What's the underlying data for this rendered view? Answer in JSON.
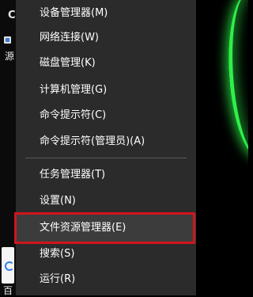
{
  "desktop": {
    "label_top": "C",
    "label_mid": "源",
    "label_bottom": "百"
  },
  "menu": {
    "items": [
      {
        "label": "设备管理器(M)"
      },
      {
        "label": "网络连接(W)"
      },
      {
        "label": "磁盘管理(K)"
      },
      {
        "label": "计算机管理(G)"
      },
      {
        "label": "命令提示符(C)"
      },
      {
        "label": "命令提示符(管理员)(A)"
      },
      {
        "label": "任务管理器(T)"
      },
      {
        "label": "设置(N)"
      },
      {
        "label": "文件资源管理器(E)"
      },
      {
        "label": "搜索(S)"
      },
      {
        "label": "运行(R)"
      }
    ],
    "highlighted_index": 8,
    "colors": {
      "background": "#2b2b2b",
      "text": "#ffffff",
      "highlight_border": "#d0151c",
      "accent_glow": "#2ef04a"
    }
  }
}
